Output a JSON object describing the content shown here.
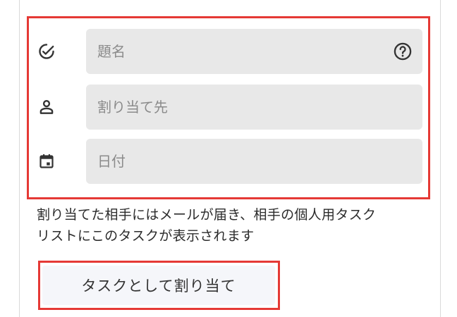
{
  "form": {
    "title": {
      "placeholder": "題名",
      "icon": "check-circle-icon",
      "help_icon": "help-circle-icon"
    },
    "assignee": {
      "placeholder": "割り当て先",
      "icon": "person-icon"
    },
    "date": {
      "placeholder": "日付",
      "icon": "calendar-icon"
    }
  },
  "description": "割り当てた相手にはメールが届き、相手の個人用タスク\nリストにこのタスクが表示されます",
  "action_button": {
    "label": "タスクとして割り当て"
  },
  "colors": {
    "highlight": "#e53935",
    "field_bg": "#e8e8e8",
    "button_bg": "#f5f6fa"
  }
}
